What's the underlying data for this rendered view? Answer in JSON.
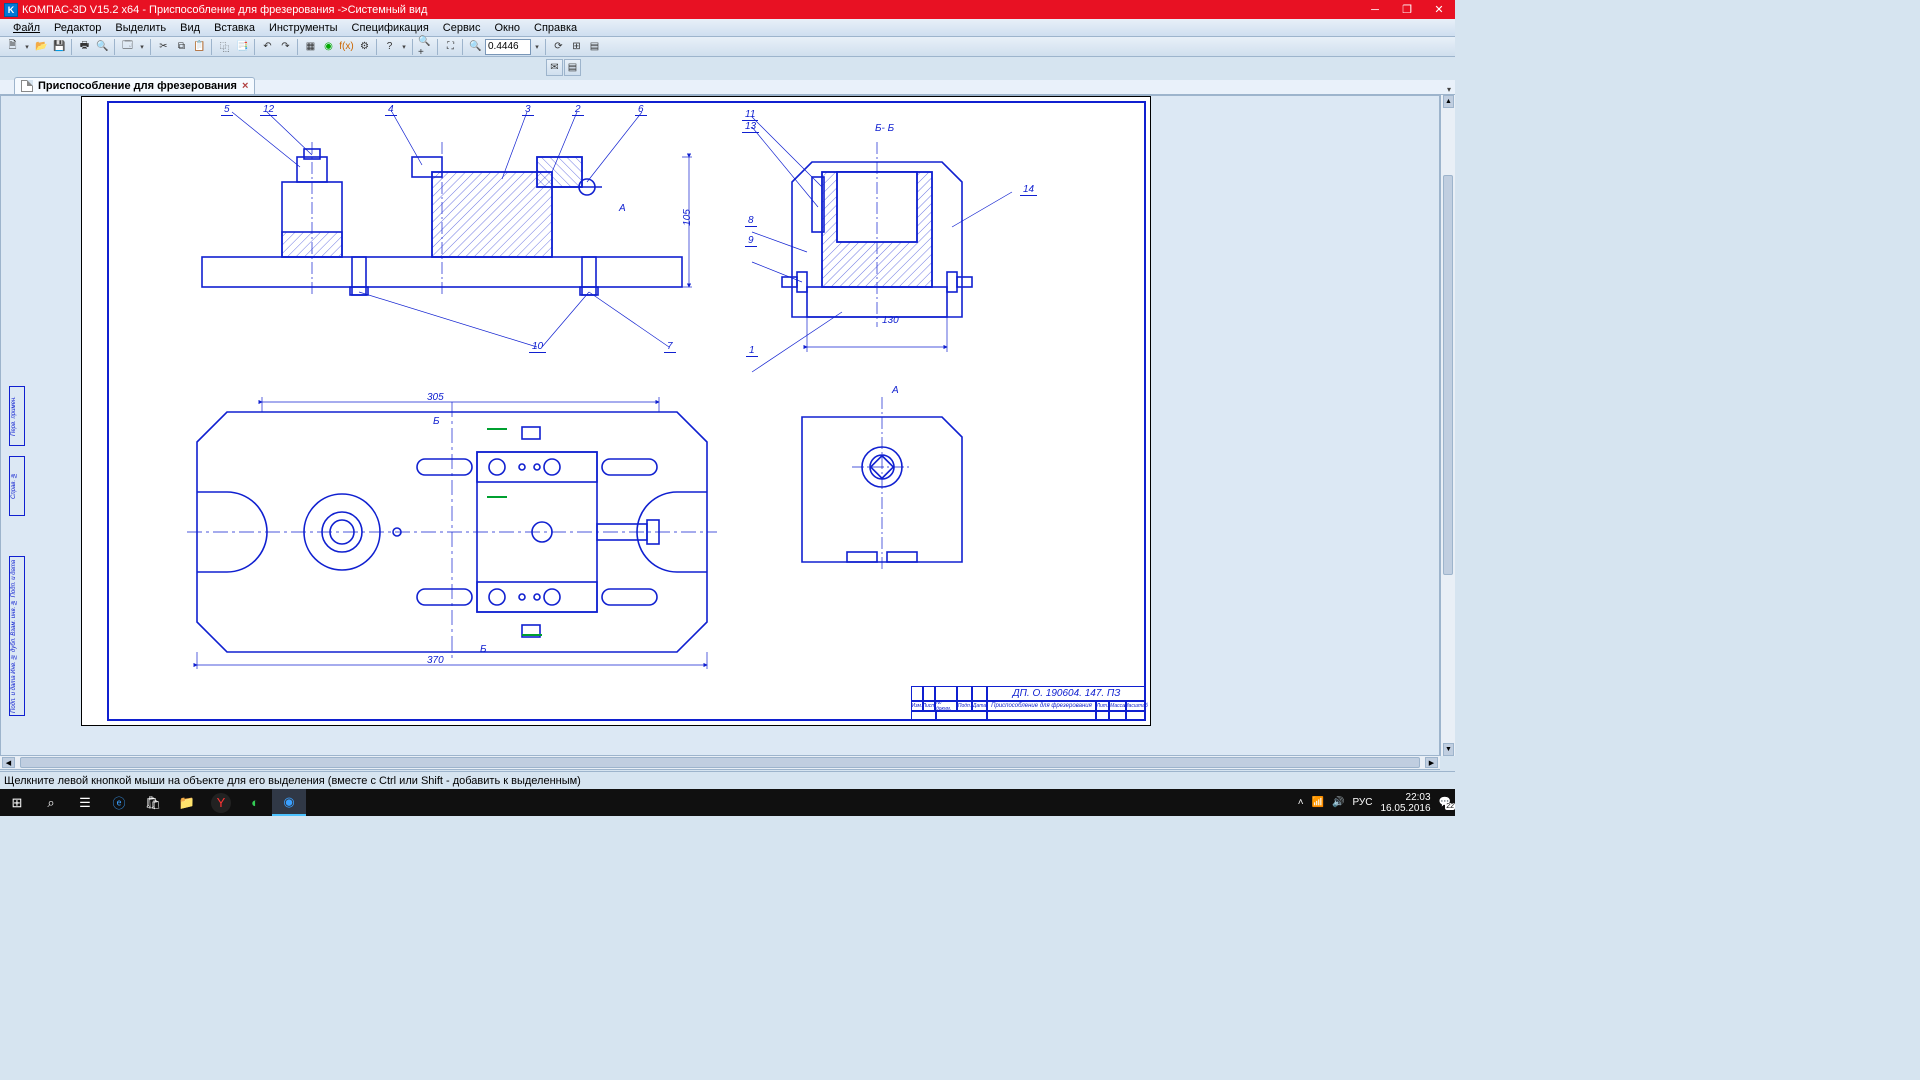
{
  "app": {
    "title": "КОМПАС-3D V15.2  x64 - Приспособление для фрезерования ->Системный вид"
  },
  "menu": {
    "items": [
      "Файл",
      "Редактор",
      "Выделить",
      "Вид",
      "Вставка",
      "Инструменты",
      "Спецификация",
      "Сервис",
      "Окно",
      "Справка"
    ]
  },
  "toolbar": {
    "zoom": "0.4446"
  },
  "tab": {
    "label": "Приспособление для фрезерования",
    "close": "×"
  },
  "drawing": {
    "pos": {
      "p1": "1",
      "p2": "2",
      "p3": "3",
      "p4": "4",
      "p5": "5",
      "p6": "6",
      "p7": "7",
      "p8": "8",
      "p9": "9",
      "p10": "10",
      "p11": "11",
      "p12": "12",
      "p13": "13",
      "p14": "14"
    },
    "sectionBB": "Б- Б",
    "viewA": "А",
    "viewA2": "А",
    "dim105": "105",
    "dim130": "130",
    "dim305": "305",
    "dim370": "370",
    "markB1": "Б",
    "markB2": "Б"
  },
  "titleblock": {
    "code": "ДП. О. 190604. 147. ПЗ",
    "name": "Приспособление для фрезерования",
    "small_cols": [
      "Изм.",
      "Лист",
      "№ докум.",
      "Подп.",
      "Дата"
    ],
    "right_small": [
      "Лит.",
      "Масса",
      "Масштаб"
    ]
  },
  "sidestrips": {
    "s1": "Перв. примен.",
    "s2": "Справ. №",
    "s3": "Подп. и дата  Инв. № дубл.  Взам. инв. №  Подп. и дата"
  },
  "status": {
    "hint": "Щелкните левой кнопкой мыши на объекте для его выделения (вместе с Ctrl или Shift - добавить к выделенным)"
  },
  "taskbar": {
    "lang": "РУС",
    "time": "22:03",
    "date": "16.05.2016",
    "notify_count": "22"
  }
}
